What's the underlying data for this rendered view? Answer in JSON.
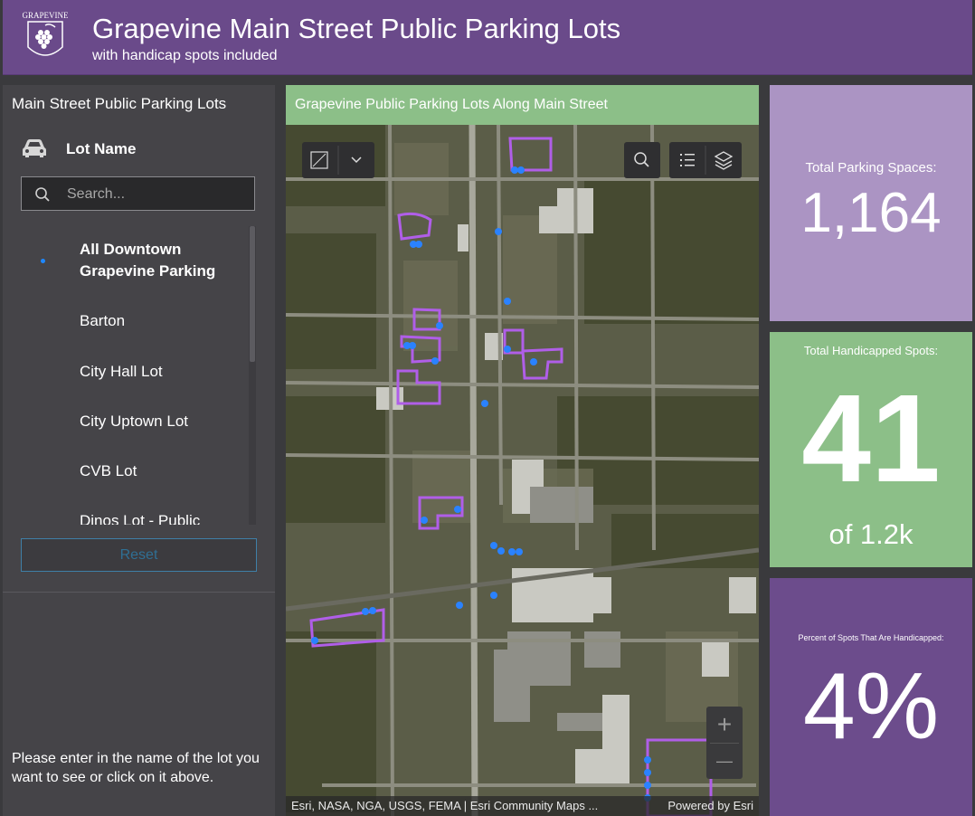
{
  "header": {
    "title": "Grapevine Main Street Public Parking Lots",
    "subtitle": "with handicap spots included",
    "logo_text": "GRAPEVINE"
  },
  "sidebar": {
    "title": "Main Street Public Parking Lots",
    "field_label": "Lot Name",
    "search_placeholder": "Search...",
    "items": [
      {
        "label": "All Downtown Grapevine Parking",
        "selected": true
      },
      {
        "label": "Barton",
        "selected": false
      },
      {
        "label": "City Hall Lot",
        "selected": false
      },
      {
        "label": "City Uptown Lot",
        "selected": false
      },
      {
        "label": "CVB Lot",
        "selected": false
      },
      {
        "label": "Dinos Lot - Public",
        "selected": false
      }
    ],
    "reset_label": "Reset",
    "instructions": "Please enter in the name of the lot you want to see or click on it above."
  },
  "map": {
    "title": "Grapevine Public Parking Lots Along Main Street",
    "attribution": "Esri, NASA, NGA, USGS, FEMA | Esri Community Maps ...",
    "powered_by": "Powered by Esri",
    "zoom_in": "+",
    "zoom_out": "—"
  },
  "stats": {
    "total_spaces_label": "Total Parking Spaces:",
    "total_spaces_value": "1,164",
    "handicapped_label": "Total Handicapped Spots:",
    "handicapped_value": "41",
    "handicapped_sub": "of 1.2k",
    "percent_label": "Percent of Spots That Are Handicapped:",
    "percent_value": "4%"
  },
  "colors": {
    "header_bg": "#6a4a8a",
    "card1_bg": "#ab94c3",
    "card2_bg": "#8cbf88",
    "card3_bg": "#6c4c8c",
    "lot_outline": "#b05ee8",
    "accent_blue": "#1e88ff"
  }
}
